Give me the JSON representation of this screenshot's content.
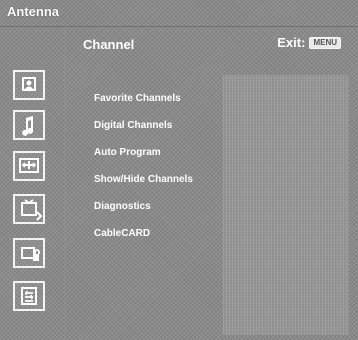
{
  "header": {
    "source": "Antenna"
  },
  "panel": {
    "title": "Channel",
    "exit": "Exit:",
    "menu_badge": "MENU",
    "items": [
      "Favorite Channels",
      "Digital Channels",
      "Auto Program",
      "Show/Hide Channels",
      "Diagnostics",
      "CableCARD"
    ]
  },
  "icons": {
    "top": [
      "picture-icon",
      "music-note-icon",
      "screen-adjust-icon",
      "channel-icon",
      "lock-icon",
      "setup-icon"
    ]
  },
  "colors": {
    "text": "#ffffff"
  }
}
